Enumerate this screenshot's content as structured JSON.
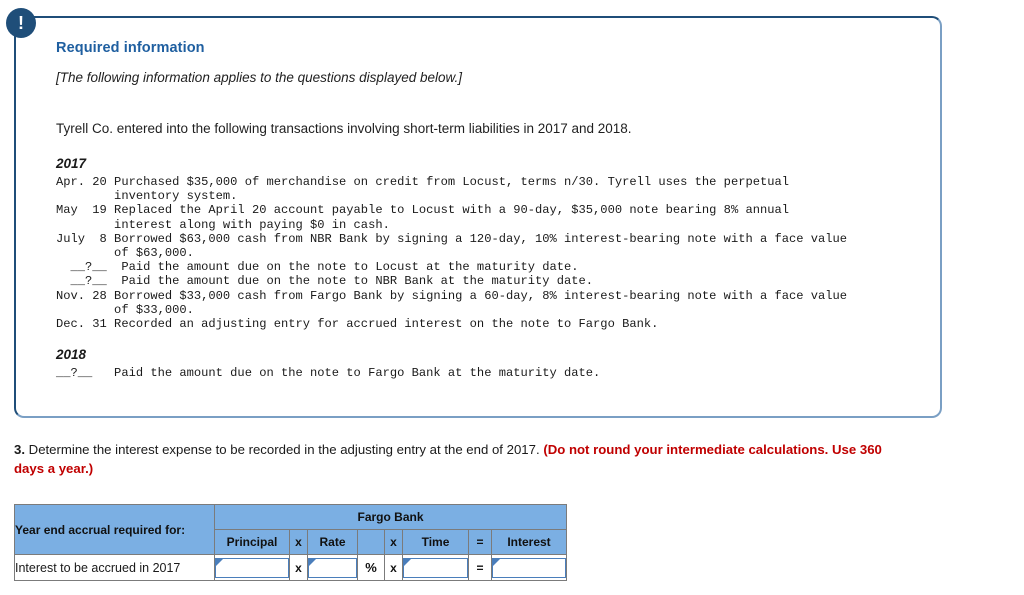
{
  "panel": {
    "alert_icon": "exclamation-icon",
    "title": "Required information",
    "italic_note": "[The following information applies to the questions displayed below.]",
    "intro": "Tyrell Co. entered into the following transactions involving short-term liabilities in 2017 and 2018.",
    "year_2017": "2017",
    "year_2018": "2018",
    "transactions_2017": "Apr. 20 Purchased $35,000 of merchandise on credit from Locust, terms n/30. Tyrell uses the perpetual\n        inventory system.\nMay  19 Replaced the April 20 account payable to Locust with a 90-day, $35,000 note bearing 8% annual\n        interest along with paying $0 in cash.\nJuly  8 Borrowed $63,000 cash from NBR Bank by signing a 120-day, 10% interest-bearing note with a face value\n        of $63,000.\n  __?__  Paid the amount due on the note to Locust at the maturity date.\n  __?__  Paid the amount due on the note to NBR Bank at the maturity date.\nNov. 28 Borrowed $33,000 cash from Fargo Bank by signing a 60-day, 8% interest-bearing note with a face value\n        of $33,000.\nDec. 31 Recorded an adjusting entry for accrued interest on the note to Fargo Bank.",
    "transactions_2018": "__?__   Paid the amount due on the note to Fargo Bank at the maturity date."
  },
  "question": {
    "number": "3.",
    "text": " Determine the interest expense to be recorded in the adjusting entry at the end of 2017. ",
    "emphasis": "(Do not round your intermediate calculations. Use 360 days a year.)"
  },
  "table": {
    "corner_header": "Year end accrual required for:",
    "bank_header": "Fargo Bank",
    "columns": {
      "principal": "Principal",
      "times1": "x",
      "rate": "Rate",
      "pct_spacer": "",
      "times2": "x",
      "time": "Time",
      "equals": "=",
      "interest": "Interest"
    },
    "rows": [
      {
        "label": "Interest to be accrued in 2017",
        "principal_value": "",
        "op1": "x",
        "rate_value": "",
        "pct": "%",
        "op2": "x",
        "time_value": "",
        "op3": "=",
        "interest_value": ""
      }
    ]
  },
  "colors": {
    "panel_border": "#1f4e79",
    "panel_border_light": "#7a9fc4",
    "title_blue": "#1f5fa0",
    "table_header_blue": "#7BAFE3",
    "emphasis_red": "#c00000",
    "field_border_blue": "#4a7ebb"
  }
}
